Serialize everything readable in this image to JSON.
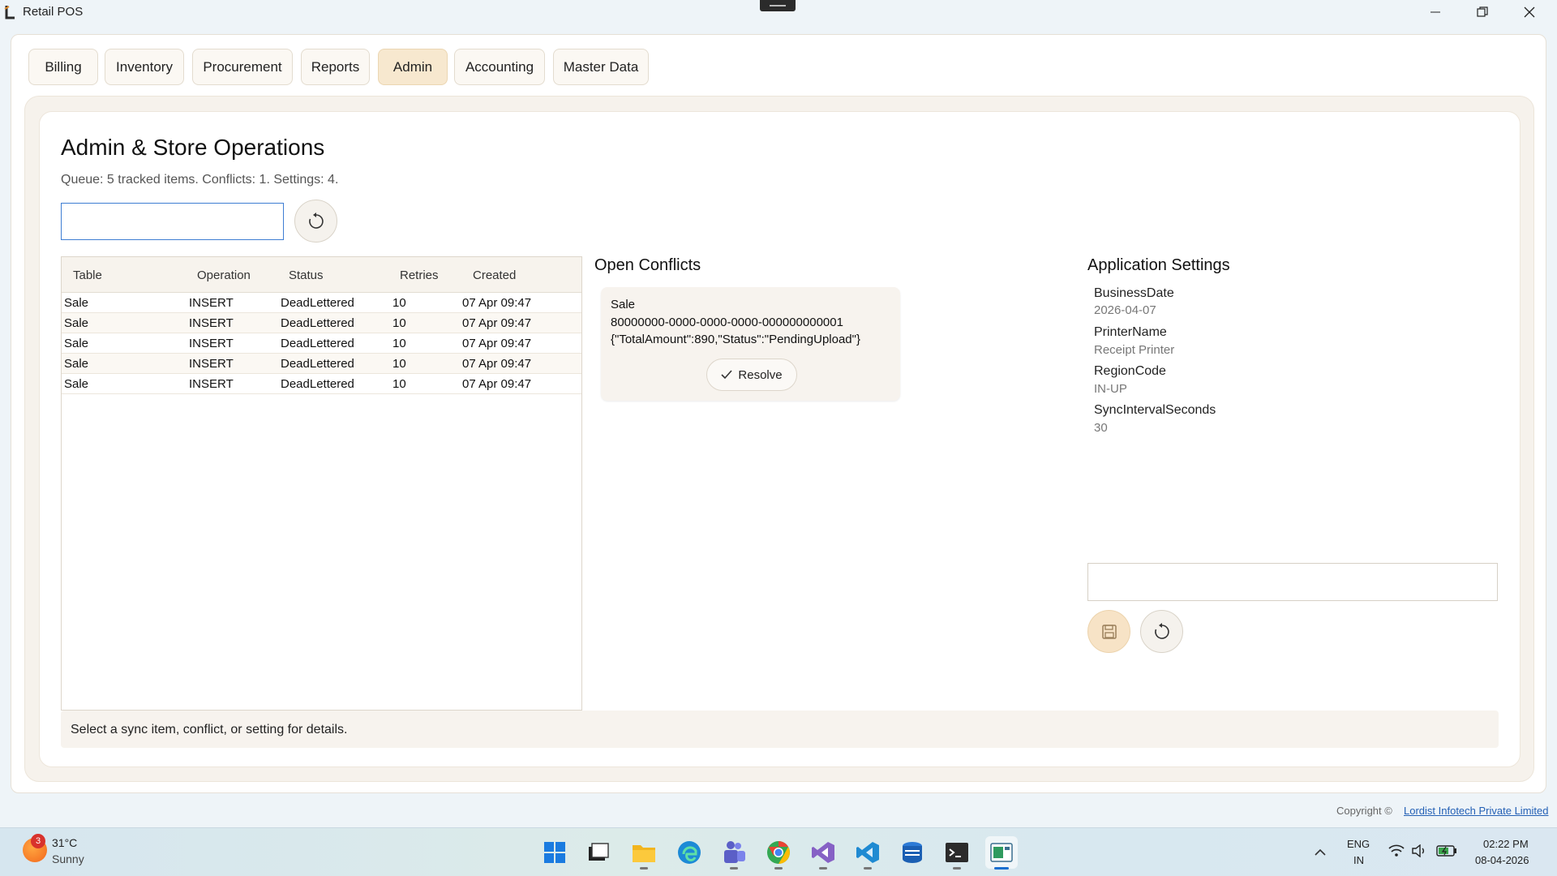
{
  "window": {
    "title": "Retail POS"
  },
  "tabs": [
    {
      "label": "Billing"
    },
    {
      "label": "Inventory"
    },
    {
      "label": "Procurement"
    },
    {
      "label": "Reports"
    },
    {
      "label": "Admin",
      "active": true
    },
    {
      "label": "Accounting"
    },
    {
      "label": "Master Data"
    }
  ],
  "page": {
    "title": "Admin & Store Operations",
    "subtitle": "Queue: 5 tracked items. Conflicts: 1. Settings: 4.",
    "search_value": ""
  },
  "queue": {
    "columns": [
      "Table",
      "Operation",
      "Status",
      "Retries",
      "Created"
    ],
    "rows": [
      [
        "Sale",
        "INSERT",
        "DeadLettered",
        "10",
        "07 Apr 09:47"
      ],
      [
        "Sale",
        "INSERT",
        "DeadLettered",
        "10",
        "07 Apr 09:47"
      ],
      [
        "Sale",
        "INSERT",
        "DeadLettered",
        "10",
        "07 Apr 09:47"
      ],
      [
        "Sale",
        "INSERT",
        "DeadLettered",
        "10",
        "07 Apr 09:47"
      ],
      [
        "Sale",
        "INSERT",
        "DeadLettered",
        "10",
        "07 Apr 09:47"
      ]
    ]
  },
  "conflicts": {
    "title": "Open Conflicts",
    "items": [
      {
        "table": "Sale",
        "id": "80000000-0000-0000-0000-000000000001",
        "payload": "{\"TotalAmount\":890,\"Status\":\"PendingUpload\"}",
        "resolve_label": "Resolve"
      }
    ]
  },
  "settings": {
    "title": "Application Settings",
    "items": [
      {
        "name": "BusinessDate",
        "value": "2026-04-07"
      },
      {
        "name": "PrinterName",
        "value": "Receipt Printer"
      },
      {
        "name": "RegionCode",
        "value": "IN-UP"
      },
      {
        "name": "SyncIntervalSeconds",
        "value": "30"
      }
    ],
    "edit_value": ""
  },
  "details": {
    "text": "Select a sync item, conflict, or setting for details."
  },
  "footer": {
    "copyright": "Copyright ©",
    "company": "Lordist Infotech Private Limited"
  },
  "taskbar": {
    "weather": {
      "temp": "31°C",
      "desc": "Sunny",
      "badge": "3"
    },
    "lang": "ENG",
    "region": "IN",
    "time": "02:22 PM",
    "date": "08-04-2026",
    "apps": [
      "start-icon",
      "task-view-icon",
      "file-explorer-icon",
      "edge-icon",
      "teams-icon",
      "chrome-icon",
      "visual-studio-icon",
      "vscode-icon",
      "azure-data-studio-icon",
      "terminal-icon",
      "retail-pos-icon"
    ]
  },
  "colors": {
    "accent": "#3f7ed3",
    "active_tab": "#f7e8cf",
    "save_button": "#f7e3c6",
    "link": "#2360b5"
  }
}
